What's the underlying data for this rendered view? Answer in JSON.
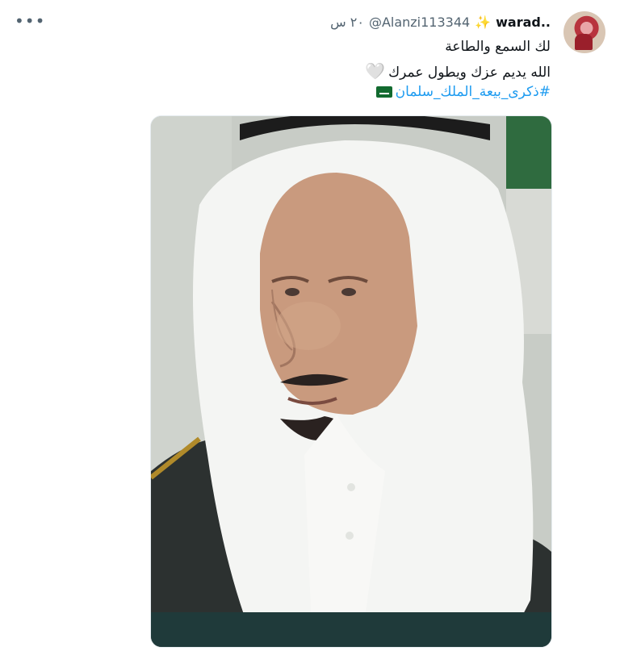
{
  "tweet": {
    "display_name": "warad..",
    "sparkle": "✨",
    "handle": "@Alanzi113344",
    "time": "٢٠ س",
    "more_icon": "•••",
    "lines": [
      "لك السمع والطاعة",
      "الله يديم عزك ويطول عمرك"
    ],
    "heart": "🤍",
    "hashtag": "#ذكرى_بيعة_الملك_سلمان"
  },
  "colors": {
    "link": "#1d9bf0",
    "muted": "#536471"
  }
}
